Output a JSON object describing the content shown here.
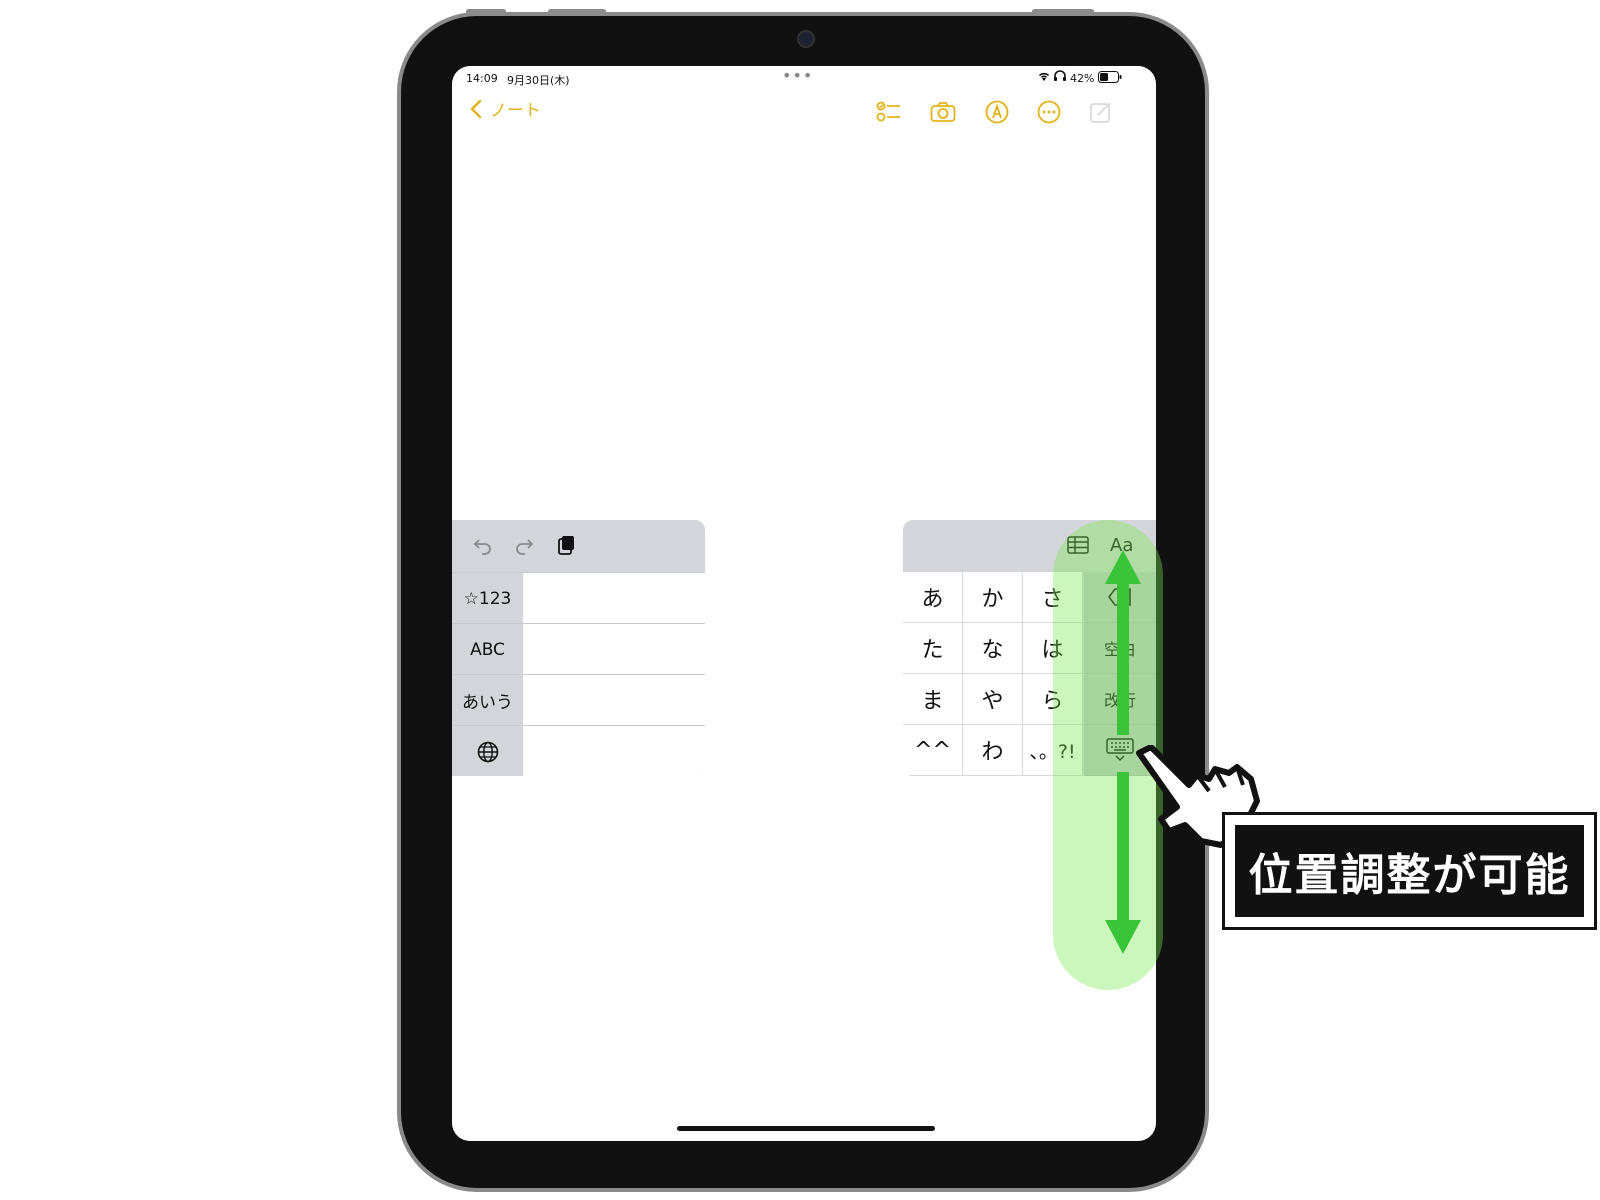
{
  "status_bar": {
    "time": "14:09",
    "date": "9月30日(木)",
    "battery": "42%"
  },
  "nav": {
    "back_label": "ノート"
  },
  "left_keyboard": {
    "rows": [
      "☆123",
      "ABC",
      "あいう"
    ]
  },
  "right_keyboard": {
    "aa_label": "Aa",
    "keys": [
      "あ",
      "か",
      "さ",
      "た",
      "な",
      "は",
      "ま",
      "や",
      "ら",
      "^^",
      "わ",
      "、。?!"
    ],
    "space_label": "空白",
    "return_label": "改行"
  },
  "callout": {
    "text": "位置調整が可能"
  },
  "colors": {
    "accent": "#e3b21a",
    "arrow": "#3ac43a"
  }
}
